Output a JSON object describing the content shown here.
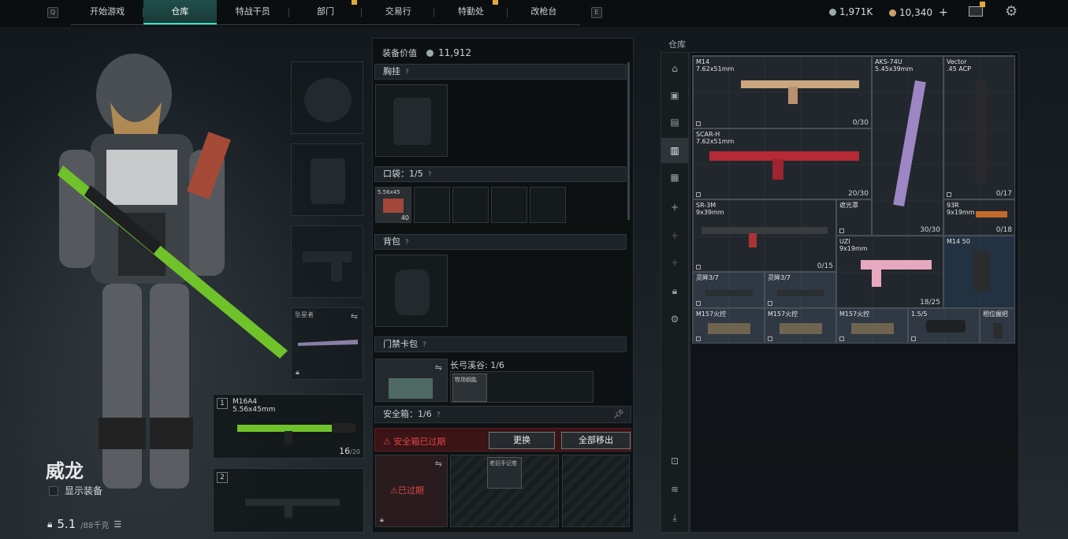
{
  "nav": {
    "key_left": "Q",
    "key_right": "E",
    "tabs": [
      "开始游戏",
      "仓库",
      "特战干员",
      "部门",
      "交易行",
      "特勤处",
      "改枪台"
    ],
    "active_tab": 1,
    "currency1": "1,971K",
    "currency2": "10,340",
    "plus": "+"
  },
  "operator": {
    "name": "威龙",
    "show_gear_label": "显示装备",
    "weight": "5.1",
    "weight_max": "/88千克"
  },
  "gear": {
    "melee_label": "坠星者",
    "primary": {
      "num": "1",
      "name": "M16A4",
      "caliber": "5.56x45mm",
      "ammo": "16",
      "ammo_max": "/20"
    },
    "secondary": {
      "num": "2"
    }
  },
  "middle": {
    "equip_value_label": "装备价值",
    "equip_value": "11,912",
    "chest_label": "胸挂",
    "pocket_label": "口袋：1/5",
    "pocket_item": {
      "name": "5.56x45",
      "count": "40"
    },
    "backpack_label": "背包",
    "keycard_label": "门禁卡包",
    "keycard_slot_label": "长弓溪谷: 1/6",
    "keycard_item": "牧场钥匙",
    "secure_label": "安全箱：1/6",
    "expired_warning": "安全箱已过期",
    "exchange_btn": "更换",
    "move_all_btn": "全部移出",
    "expired_tag": "已过期",
    "secure_item": "老旧手记卷"
  },
  "warehouse": {
    "title": "仓库",
    "items": [
      {
        "name": "M14\n7.62x51mm",
        "ammo": "0/30"
      },
      {
        "name": "AKS-74U\n5.45x39mm",
        "ammo": "30/30"
      },
      {
        "name": "Vector\n.45 ACP",
        "ammo": "0/17"
      },
      {
        "name": "SCAR-H\n7.62x51mm",
        "ammo": "20/30"
      },
      {
        "name": "SR-3M\n9x39mm",
        "ammo": "0/15"
      },
      {
        "name": "遮光罩",
        "ammo": ""
      },
      {
        "name": "93R\n9x19mm",
        "ammo": "0/18"
      },
      {
        "name": "UZI\n9x19mm",
        "ammo": "18/25"
      },
      {
        "name": "M14 50",
        "ammo": ""
      },
      {
        "name": "灵眸3/7",
        "ammo": ""
      },
      {
        "name": "灵眸3/7",
        "ammo": ""
      },
      {
        "name": "M157火控",
        "ammo": ""
      },
      {
        "name": "M157火控",
        "ammo": ""
      },
      {
        "name": "M157火控",
        "ammo": ""
      },
      {
        "name": "1.5/5",
        "ammo": ""
      },
      {
        "name": "相位握把",
        "ammo": ""
      }
    ]
  },
  "colors": {
    "accent": "#3fe0c5",
    "warning": "#e04646",
    "notif": "#e0a83b",
    "primary_weapon": "#6fc22a"
  }
}
